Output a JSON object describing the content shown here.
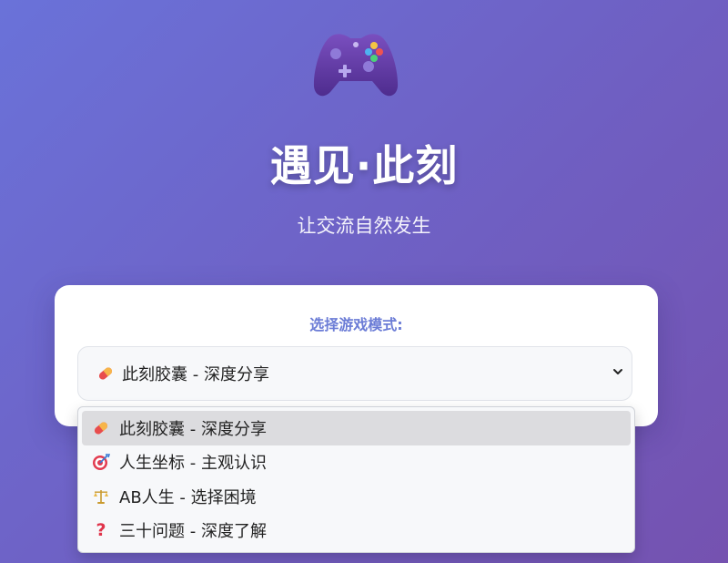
{
  "app": {
    "title": "遇见·此刻",
    "subtitle": "让交流自然发生",
    "logo_icon": "gamepad-icon"
  },
  "mode_select": {
    "label": "选择游戏模式:",
    "selected": "此刻胶囊 - 深度分享",
    "selected_icon": "pill-icon",
    "options": [
      {
        "label": "此刻胶囊 - 深度分享",
        "icon": "pill-icon",
        "selected": true
      },
      {
        "label": "人生坐标 - 主观认识",
        "icon": "target-icon",
        "selected": false
      },
      {
        "label": "AB人生 - 选择困境",
        "icon": "scales-icon",
        "selected": false
      },
      {
        "label": "三十问题 - 深度了解",
        "icon": "question-icon",
        "selected": false
      }
    ]
  },
  "colors": {
    "background_start": "#6a72d9",
    "background_end": "#7552b0",
    "label_accent": "#6b7cd6",
    "selected_option_bg": "#dcdcdf"
  }
}
